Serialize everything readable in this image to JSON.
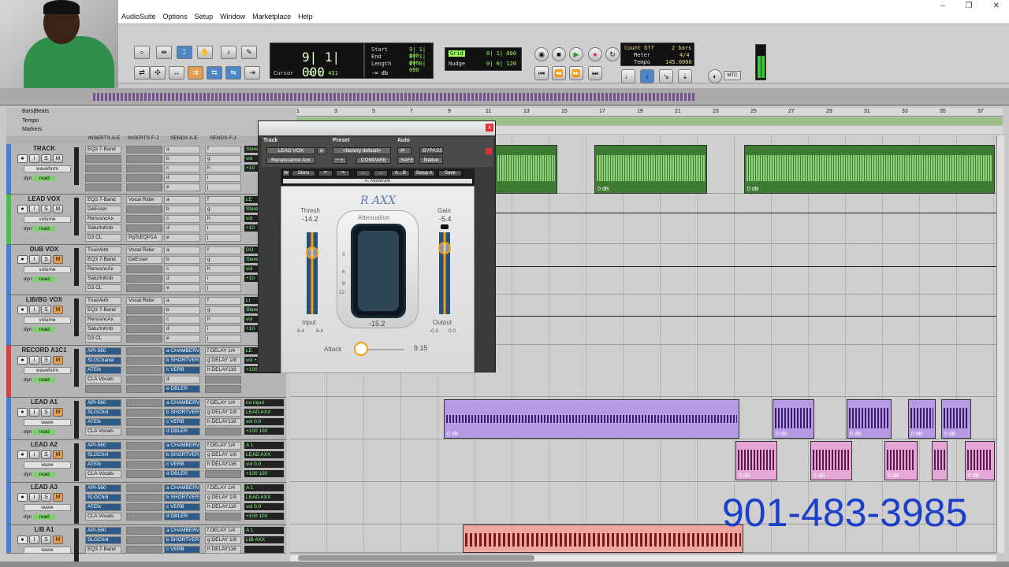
{
  "menu": [
    "AudioSuite",
    "Options",
    "Setup",
    "Window",
    "Marketplace",
    "Help"
  ],
  "window_controls": {
    "minimize": "–",
    "restore": "❐",
    "close": "✕"
  },
  "toolbar": {
    "counter_main": "9| 1| 000",
    "cursor_label": "Cursor",
    "cursor_value": "1| 1| 431",
    "counter_db": "-∞ db",
    "start_label": "Start",
    "start_value": "9| 1| 000",
    "end_label": "End",
    "end_value": "9| 1| 000",
    "length_label": "Length",
    "length_value": "0| 0| 000",
    "grid_label": "Grid",
    "grid_value": "0| 1| 000",
    "nudge_label": "Nudge",
    "nudge_value": "0| 0| 120",
    "count_off": "Count Off",
    "count_off_value": "2 bars",
    "meter_label": "Meter",
    "meter_value": "4/4",
    "tempo_label": "Tempo",
    "tempo_value": "145.0000",
    "mtc": "MTC"
  },
  "rulers": {
    "bars_beats": "Bars|Beats",
    "tempo": "Tempo",
    "markers": "Markers",
    "ticks": [
      "1",
      "3",
      "5",
      "7",
      "9",
      "11",
      "13",
      "15",
      "17",
      "19",
      "21",
      "23",
      "25",
      "27",
      "29",
      "31",
      "33",
      "35",
      "37"
    ]
  },
  "mix_columns": [
    "INSERTS A-E",
    "INSERTS F-J",
    "SENDS A-E",
    "SENDS F-J"
  ],
  "tracks": [
    {
      "name": "TRACK",
      "mode": "waveform",
      "auto": "read",
      "insA": [
        "EQ3 7-Band",
        "",
        "",
        "",
        ""
      ],
      "insF": [
        "",
        "",
        "",
        "",
        ""
      ],
      "sendA": [
        "a",
        "b",
        "c",
        "d",
        "e"
      ],
      "sendF": [
        "f",
        "g",
        "h",
        "i",
        "j"
      ],
      "io": [
        "Stere",
        "vol",
        "+10"
      ],
      "color": "#4a7fd6"
    },
    {
      "name": "LEAD VOX",
      "mode": "volume",
      "auto": "read",
      "insA": [
        "EQ3 7-Band",
        "DeEsser",
        "RenssncAx",
        "SaturtnKnb",
        "D3 CL"
      ],
      "insF": [
        "Vocal Rider",
        "",
        "",
        "",
        "PgTcEQP1A"
      ],
      "sendA": [
        "a",
        "b",
        "c",
        "d",
        "e"
      ],
      "sendF": [
        "f",
        "g",
        "h",
        "i",
        "j"
      ],
      "io": [
        "LE",
        "Stere",
        "vol",
        "+10"
      ],
      "color": "#4bbf4b"
    },
    {
      "name": "DUB VOX",
      "mode": "volume",
      "auto": "read",
      "insA": [
        "TrueVerb",
        "EQ3 7-Band",
        "RenssncAx",
        "SaturtnKnb",
        "D3 CL"
      ],
      "insF": [
        "Vocal Rider",
        "DeEsser",
        "",
        "",
        ""
      ],
      "sendA": [
        "a",
        "b",
        "c",
        "d",
        "e"
      ],
      "sendF": [
        "f",
        "g",
        "h",
        "i",
        "j"
      ],
      "io": [
        "DU",
        "Stere",
        "vol",
        "+10"
      ],
      "color": "#4a7fd6"
    },
    {
      "name": "LIB/BG VOX",
      "mode": "volume",
      "auto": "read",
      "insA": [
        "TrueVerb",
        "EQ3 7-Band",
        "RenssncAx",
        "SaturtnKnb",
        "D3 CL"
      ],
      "insF": [
        "Vocal Rider",
        "",
        "",
        "",
        ""
      ],
      "sendA": [
        "a",
        "b",
        "c",
        "d",
        "e"
      ],
      "sendF": [
        "f",
        "g",
        "h",
        "i",
        "j"
      ],
      "io": [
        "LI",
        "Stere",
        "vol",
        "+10"
      ],
      "color": "#4a7fd6"
    },
    {
      "name": "RECORD A1C1",
      "mode": "waveform",
      "auto": "read",
      "insA": [
        "API-560",
        "SLGChanel",
        "ATEfx",
        "CLA Vocals",
        ""
      ],
      "insF": [
        "",
        "",
        "",
        "",
        ""
      ],
      "sendA": [
        "a CHAMBERV",
        "b SHORTVER",
        "c VERB",
        "d",
        "e DBLER"
      ],
      "sendF": [
        "f DELAY 1/4",
        "g DELAY 1/8",
        "h DELAY116",
        "",
        ""
      ],
      "io": [
        "LE",
        "vol +12.0",
        "+100 100"
      ],
      "color": "#d94040"
    },
    {
      "name": "LEAD A1",
      "mode": "wave",
      "auto": "read",
      "insA": [
        "API-560",
        "SLGChnl",
        "ATEfx",
        "CLA Vocals",
        ""
      ],
      "insF": [
        "",
        "",
        "",
        "",
        ""
      ],
      "sendA": [
        "a CHAMBERV",
        "b SHORTVER",
        "c VERB",
        "d DBLER"
      ],
      "sendF": [
        "f DELAY 1/4",
        "g DELAY 1/8",
        "h DELAY116",
        ""
      ],
      "io": [
        "no input",
        "LEAD AXX",
        "vol 0.0",
        "+100 100"
      ],
      "color": "#4a7fd6"
    },
    {
      "name": "LEAD A2",
      "mode": "wave",
      "auto": "read",
      "insA": [
        "API-560",
        "SLGChnl",
        "ATEfx",
        "CLA Vocals"
      ],
      "insF": [
        "",
        "",
        "",
        ""
      ],
      "sendA": [
        "a CHAMBERV",
        "b SHORTVER",
        "c VERB",
        "d DBLER"
      ],
      "sendF": [
        "f DELAY 1/4",
        "g DELAY 1/8",
        "h DELAY116",
        ""
      ],
      "io": [
        "A 1",
        "LEAD AXX",
        "vol 0.0",
        "+100 100"
      ],
      "color": "#4a7fd6"
    },
    {
      "name": "LEAD A3",
      "mode": "wave",
      "auto": "read",
      "insA": [
        "API-560",
        "SLGChnl",
        "ATEfx",
        "CLA Vocals"
      ],
      "insF": [
        "",
        "",
        "",
        ""
      ],
      "sendA": [
        "a CHAMBERV",
        "b SHORTVER",
        "c VERB",
        "d DBLER"
      ],
      "sendF": [
        "f DELAY 1/4",
        "g DELAY 1/8",
        "h DELAY116",
        ""
      ],
      "io": [
        "A 1",
        "LEAD AXX",
        "vol 0.0",
        "+100 100"
      ],
      "color": "#4a7fd6"
    },
    {
      "name": "LIB A1",
      "mode": "wave",
      "auto": "read",
      "insA": [
        "API-560",
        "SLGChnl",
        "EQ3 7-Band"
      ],
      "insF": [
        "",
        "",
        ""
      ],
      "sendA": [
        "a CHAMBERV",
        "b SHORTVER",
        "c VERB"
      ],
      "sendF": [
        "f DELAY 1/4",
        "g DELAY 1/8",
        "h DELAY116"
      ],
      "io": [
        "A 1",
        "LIB AXX",
        ""
      ],
      "color": "#4a7fd6"
    }
  ],
  "plugin": {
    "track_label": "Track",
    "preset_label": "Preset",
    "auto_label": "Auto",
    "track_name": "LEAD VOX",
    "track_suffix": "e",
    "preset_name": "<factory default>",
    "compare": "COMPARE",
    "bypass": "BYPASS",
    "plugin_name": "Renaissance Axx",
    "safe": "SAFE",
    "native": "Native",
    "skins": "Skins",
    "setup": "Setup A",
    "save": "Save",
    "preset_display": "A: Moderate",
    "logo": "R AXX",
    "thresh_label": "Thresh",
    "thresh_value": "-14.2",
    "attenuation_label": "Attenuation",
    "attenuation_value": "-15.2",
    "gain_label": "Gain",
    "gain_value": "-5.4",
    "input_label": "Input",
    "input_l": "6.4",
    "input_r": "6.4",
    "output_label": "Output",
    "output_l": "-0.0",
    "output_r": "0.0",
    "scale": [
      "3",
      "6",
      "9",
      "12"
    ],
    "attack_label": "Attack",
    "attack_value": "9.15",
    "close": "x"
  },
  "clips_db": "0 dB",
  "overlay_phone": "901-483-3985"
}
